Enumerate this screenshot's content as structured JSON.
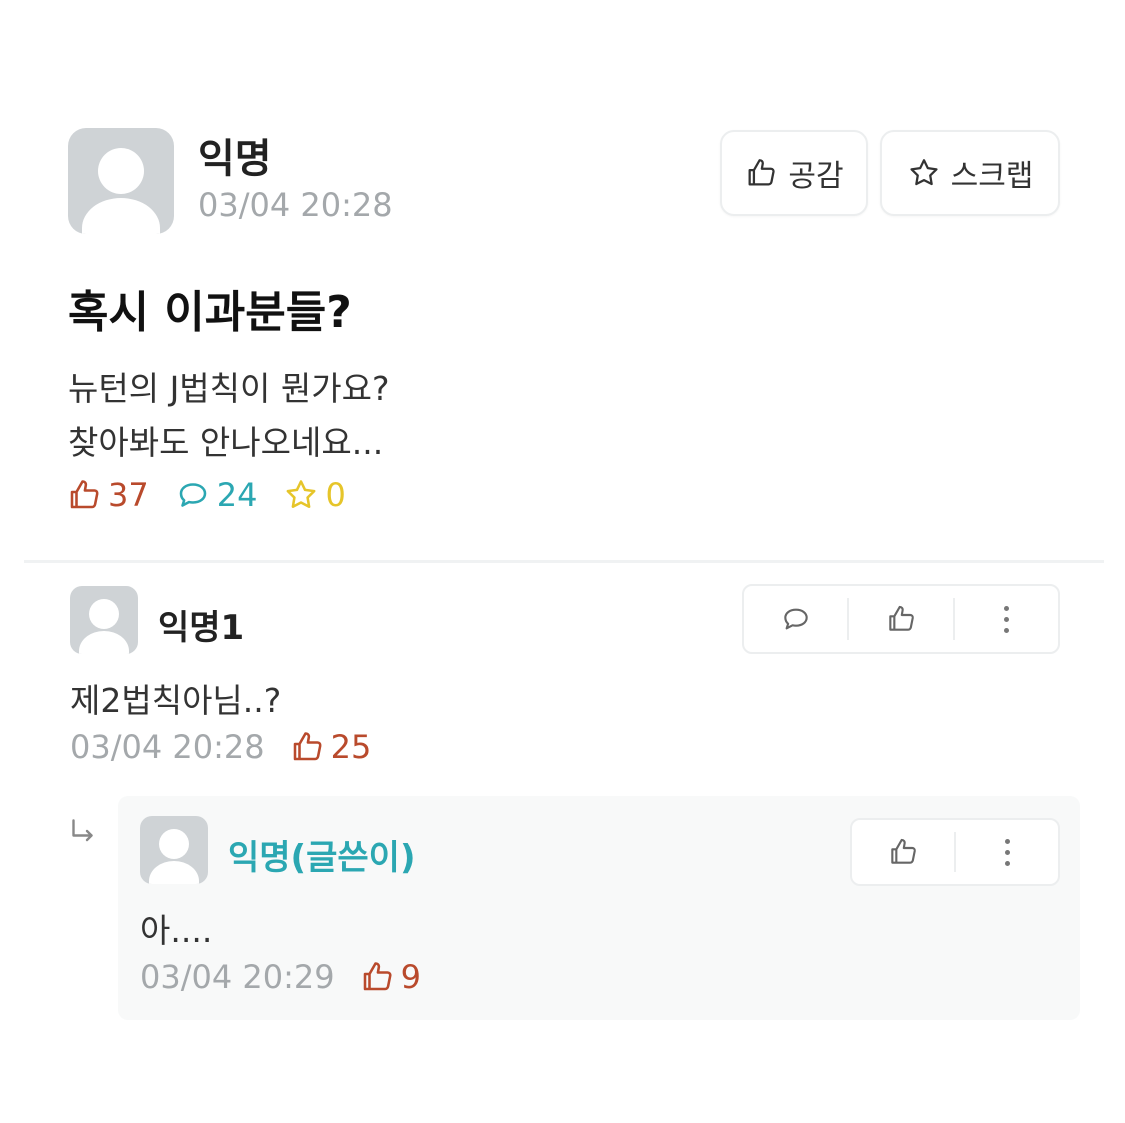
{
  "post": {
    "author": "익명",
    "time": "03/04 20:28",
    "like_button_label": "공감",
    "scrap_button_label": "스크랩",
    "title": "혹시 이과분들?",
    "body_line1": "뉴턴의 J법칙이 뭔가요?",
    "body_line2": "찾아봐도 안나오네요...",
    "likes": "37",
    "comments": "24",
    "scraps": "0"
  },
  "comment": {
    "author": "익명1",
    "text": "제2법칙아님..?",
    "time": "03/04 20:28",
    "likes": "25"
  },
  "reply": {
    "author": "익명(글쓴이)",
    "text": "아....",
    "time": "03/04 20:29",
    "likes": "9"
  },
  "colors": {
    "like": "#b94a2c",
    "comment": "#2ba7b2",
    "scrap": "#e6c52a",
    "op_author": "#2ba7b2",
    "muted": "#a4a8ab"
  },
  "icons": [
    "thumbs-up-icon",
    "star-icon",
    "speech-bubble-icon",
    "more-vertical-icon",
    "reply-arrow-icon",
    "avatar-icon"
  ]
}
